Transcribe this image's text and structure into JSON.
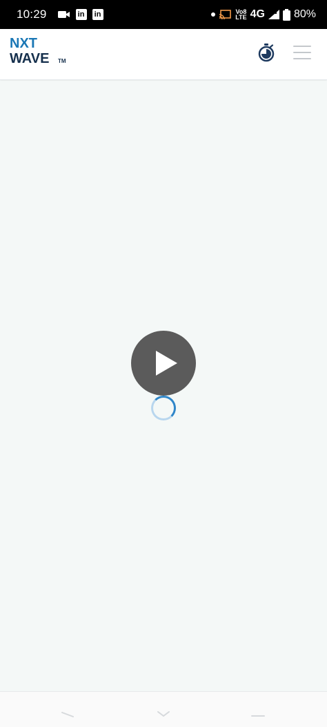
{
  "status_bar": {
    "time": "10:29",
    "linkedin_letters": "in",
    "volte_line1": "Vo8",
    "volte_line2": "LTE",
    "network": "4G",
    "battery": "80%"
  },
  "header": {
    "logo_line1": "NXT",
    "logo_line2": "WAVE",
    "logo_tm": "TM",
    "timer_icon": "stopwatch-icon",
    "menu_icon": "hamburger-menu-icon"
  },
  "video": {
    "play_icon": "play-icon",
    "spinner": "loading-spinner"
  },
  "colors": {
    "status_bg": "#000000",
    "header_bg": "#ffffff",
    "page_bg": "#f4f8f7",
    "logo_blue": "#1a77b5",
    "logo_navy": "#16304d",
    "play_bg": "#5b5b5b",
    "spinner_blue": "#2f86c9"
  }
}
